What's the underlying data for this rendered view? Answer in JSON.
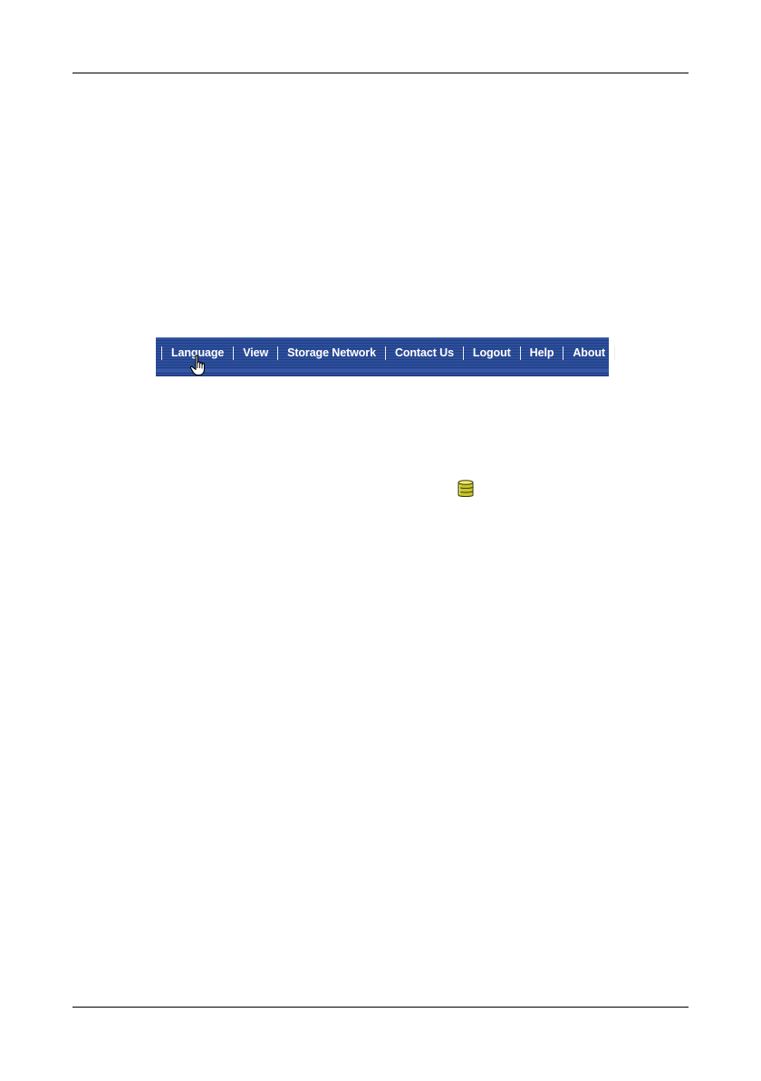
{
  "page": {
    "number": ""
  },
  "menu": {
    "items": [
      {
        "label": "Language"
      },
      {
        "label": "View"
      },
      {
        "label": "Storage Network"
      },
      {
        "label": "Contact Us"
      },
      {
        "label": "Logout"
      },
      {
        "label": "Help"
      },
      {
        "label": "About"
      }
    ],
    "colors": {
      "bar": "#2a4a95",
      "text": "#ffffff"
    }
  },
  "icons": {
    "cursor": "hand-pointer-icon",
    "database": "storage-database-icon"
  }
}
